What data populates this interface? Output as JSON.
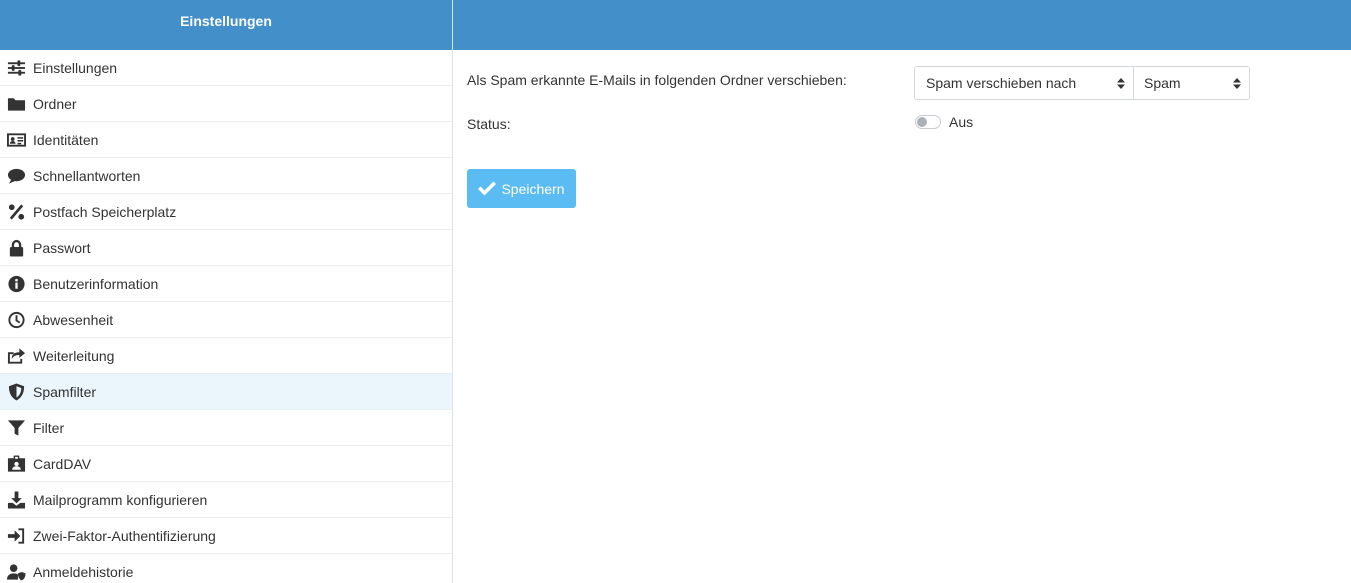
{
  "sidebar": {
    "title": "Einstellungen",
    "items": [
      {
        "label": "Einstellungen",
        "icon": "sliders-icon"
      },
      {
        "label": "Ordner",
        "icon": "folder-icon"
      },
      {
        "label": "Identitäten",
        "icon": "id-card-icon"
      },
      {
        "label": "Schnellantworten",
        "icon": "comment-icon"
      },
      {
        "label": "Postfach Speicherplatz",
        "icon": "percent-icon"
      },
      {
        "label": "Passwort",
        "icon": "lock-icon"
      },
      {
        "label": "Benutzerinformation",
        "icon": "info-icon"
      },
      {
        "label": "Abwesenheit",
        "icon": "clock-icon"
      },
      {
        "label": "Weiterleitung",
        "icon": "share-icon"
      },
      {
        "label": "Spamfilter",
        "icon": "shield-icon",
        "active": true
      },
      {
        "label": "Filter",
        "icon": "filter-icon"
      },
      {
        "label": "CardDAV",
        "icon": "contact-badge-icon"
      },
      {
        "label": "Mailprogramm konfigurieren",
        "icon": "download-icon"
      },
      {
        "label": "Zwei-Faktor-Authentifizierung",
        "icon": "sign-in-icon"
      },
      {
        "label": "Anmeldehistorie",
        "icon": "user-shield-icon"
      }
    ]
  },
  "form": {
    "spam_label": "Als Spam erkannte E-Mails in folgenden Ordner verschieben:",
    "action_select": "Spam verschieben nach",
    "folder_select": "Spam",
    "status_label": "Status:",
    "status_value": "Aus",
    "save_label": "Speichern"
  },
  "colors": {
    "header": "#428fc9",
    "active_item": "#eaf6fc",
    "save_button": "#5bbcf3"
  }
}
